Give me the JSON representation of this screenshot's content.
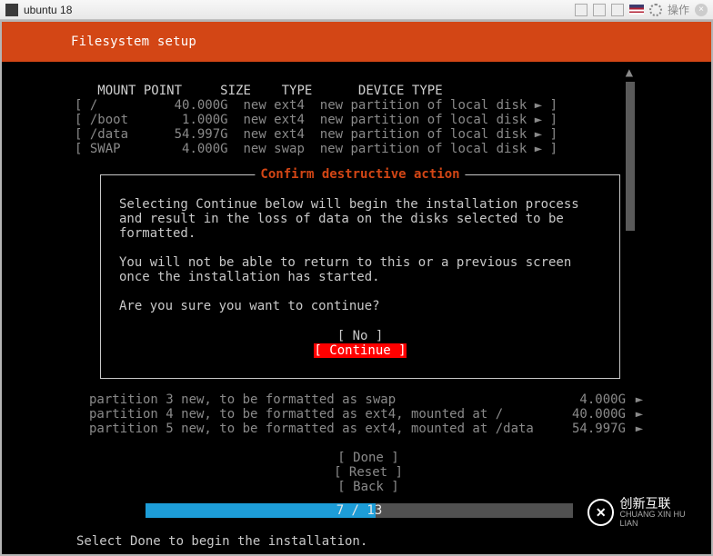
{
  "titlebar": {
    "vm_name": "ubuntu 18",
    "action_label": "操作"
  },
  "header": {
    "title": "Filesystem setup"
  },
  "table": {
    "columns": {
      "c1": "MOUNT POINT",
      "c2": "SIZE",
      "c3": "TYPE",
      "c4": "DEVICE TYPE"
    },
    "rows": [
      {
        "mp": "/",
        "size": "40.000G",
        "type": "new ext4",
        "device": "new partition of local disk"
      },
      {
        "mp": "/boot",
        "size": "1.000G",
        "type": "new ext4",
        "device": "new partition of local disk"
      },
      {
        "mp": "/data",
        "size": "54.997G",
        "type": "new ext4",
        "device": "new partition of local disk"
      },
      {
        "mp": "SWAP",
        "size": "4.000G",
        "type": "new swap",
        "device": "new partition of local disk"
      }
    ]
  },
  "modal": {
    "title": "Confirm destructive action",
    "p1": "Selecting Continue below will begin the installation process and result in the loss of data on the disks selected to be formatted.",
    "p2": "You will not be able to return to this or a previous screen once the installation has started.",
    "p3": "Are you sure you want to continue?",
    "no_label": "No",
    "continue_label": "Continue"
  },
  "partitions": [
    {
      "label": "partition 3  new, to be formatted as swap",
      "size": "4.000G"
    },
    {
      "label": "partition 4  new, to be formatted as ext4, mounted at /",
      "size": "40.000G"
    },
    {
      "label": "partition 5  new, to be formatted as ext4, mounted at /data",
      "size": "54.997G"
    }
  ],
  "bottom_buttons": {
    "done": "Done",
    "reset": "Reset",
    "back": "Back"
  },
  "progress": {
    "current": 7,
    "total": 13,
    "text": "7 / 13",
    "percent": 53.8
  },
  "footer": "Select Done to begin the installation.",
  "watermark": {
    "logo": "✕",
    "line1": "创新互联",
    "line2": "CHUANG XIN HU LIAN"
  }
}
